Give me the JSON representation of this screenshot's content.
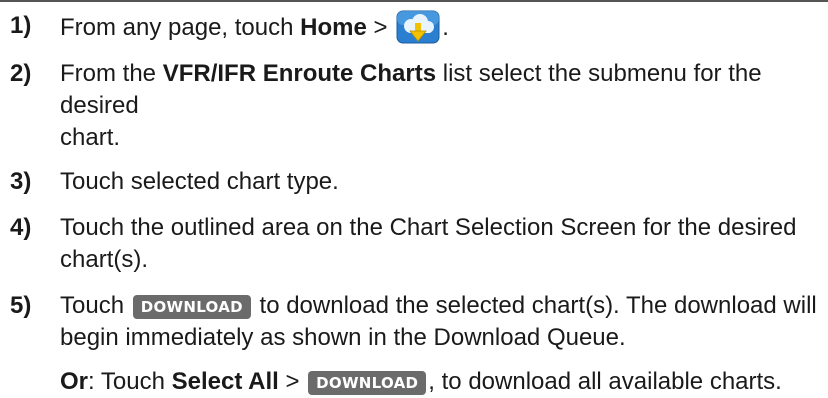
{
  "steps": [
    {
      "num": "1)",
      "parts": [
        "From any page, touch ",
        "Home",
        " > ",
        "."
      ],
      "icon": "download-cloud-icon"
    },
    {
      "num": "2)",
      "parts": [
        "From the ",
        "VFR/IFR Enroute Charts",
        " list select the submenu for the desired",
        "chart."
      ]
    },
    {
      "num": "3)",
      "text": "Touch selected chart type."
    },
    {
      "num": "4)",
      "line1": "Touch the outlined area on the Chart Selection Screen for the desired",
      "line2": "chart(s)."
    },
    {
      "num": "5)",
      "pre": "Touch ",
      "button": "DOWNLOAD",
      "post": " to download the selected chart(s). The download will",
      "line2": "begin immediately as shown in the Download Queue."
    }
  ],
  "or_line": {
    "or_label": "Or",
    "colon": ": Touch ",
    "select_all": "Select All",
    "gt": " > ",
    "button": "DOWNLOAD",
    "post": ", to download all available charts."
  },
  "colors": {
    "button_bg": "#6b6b6b",
    "icon_bg": "#2a7fd0",
    "arrow": "#f2c200"
  }
}
